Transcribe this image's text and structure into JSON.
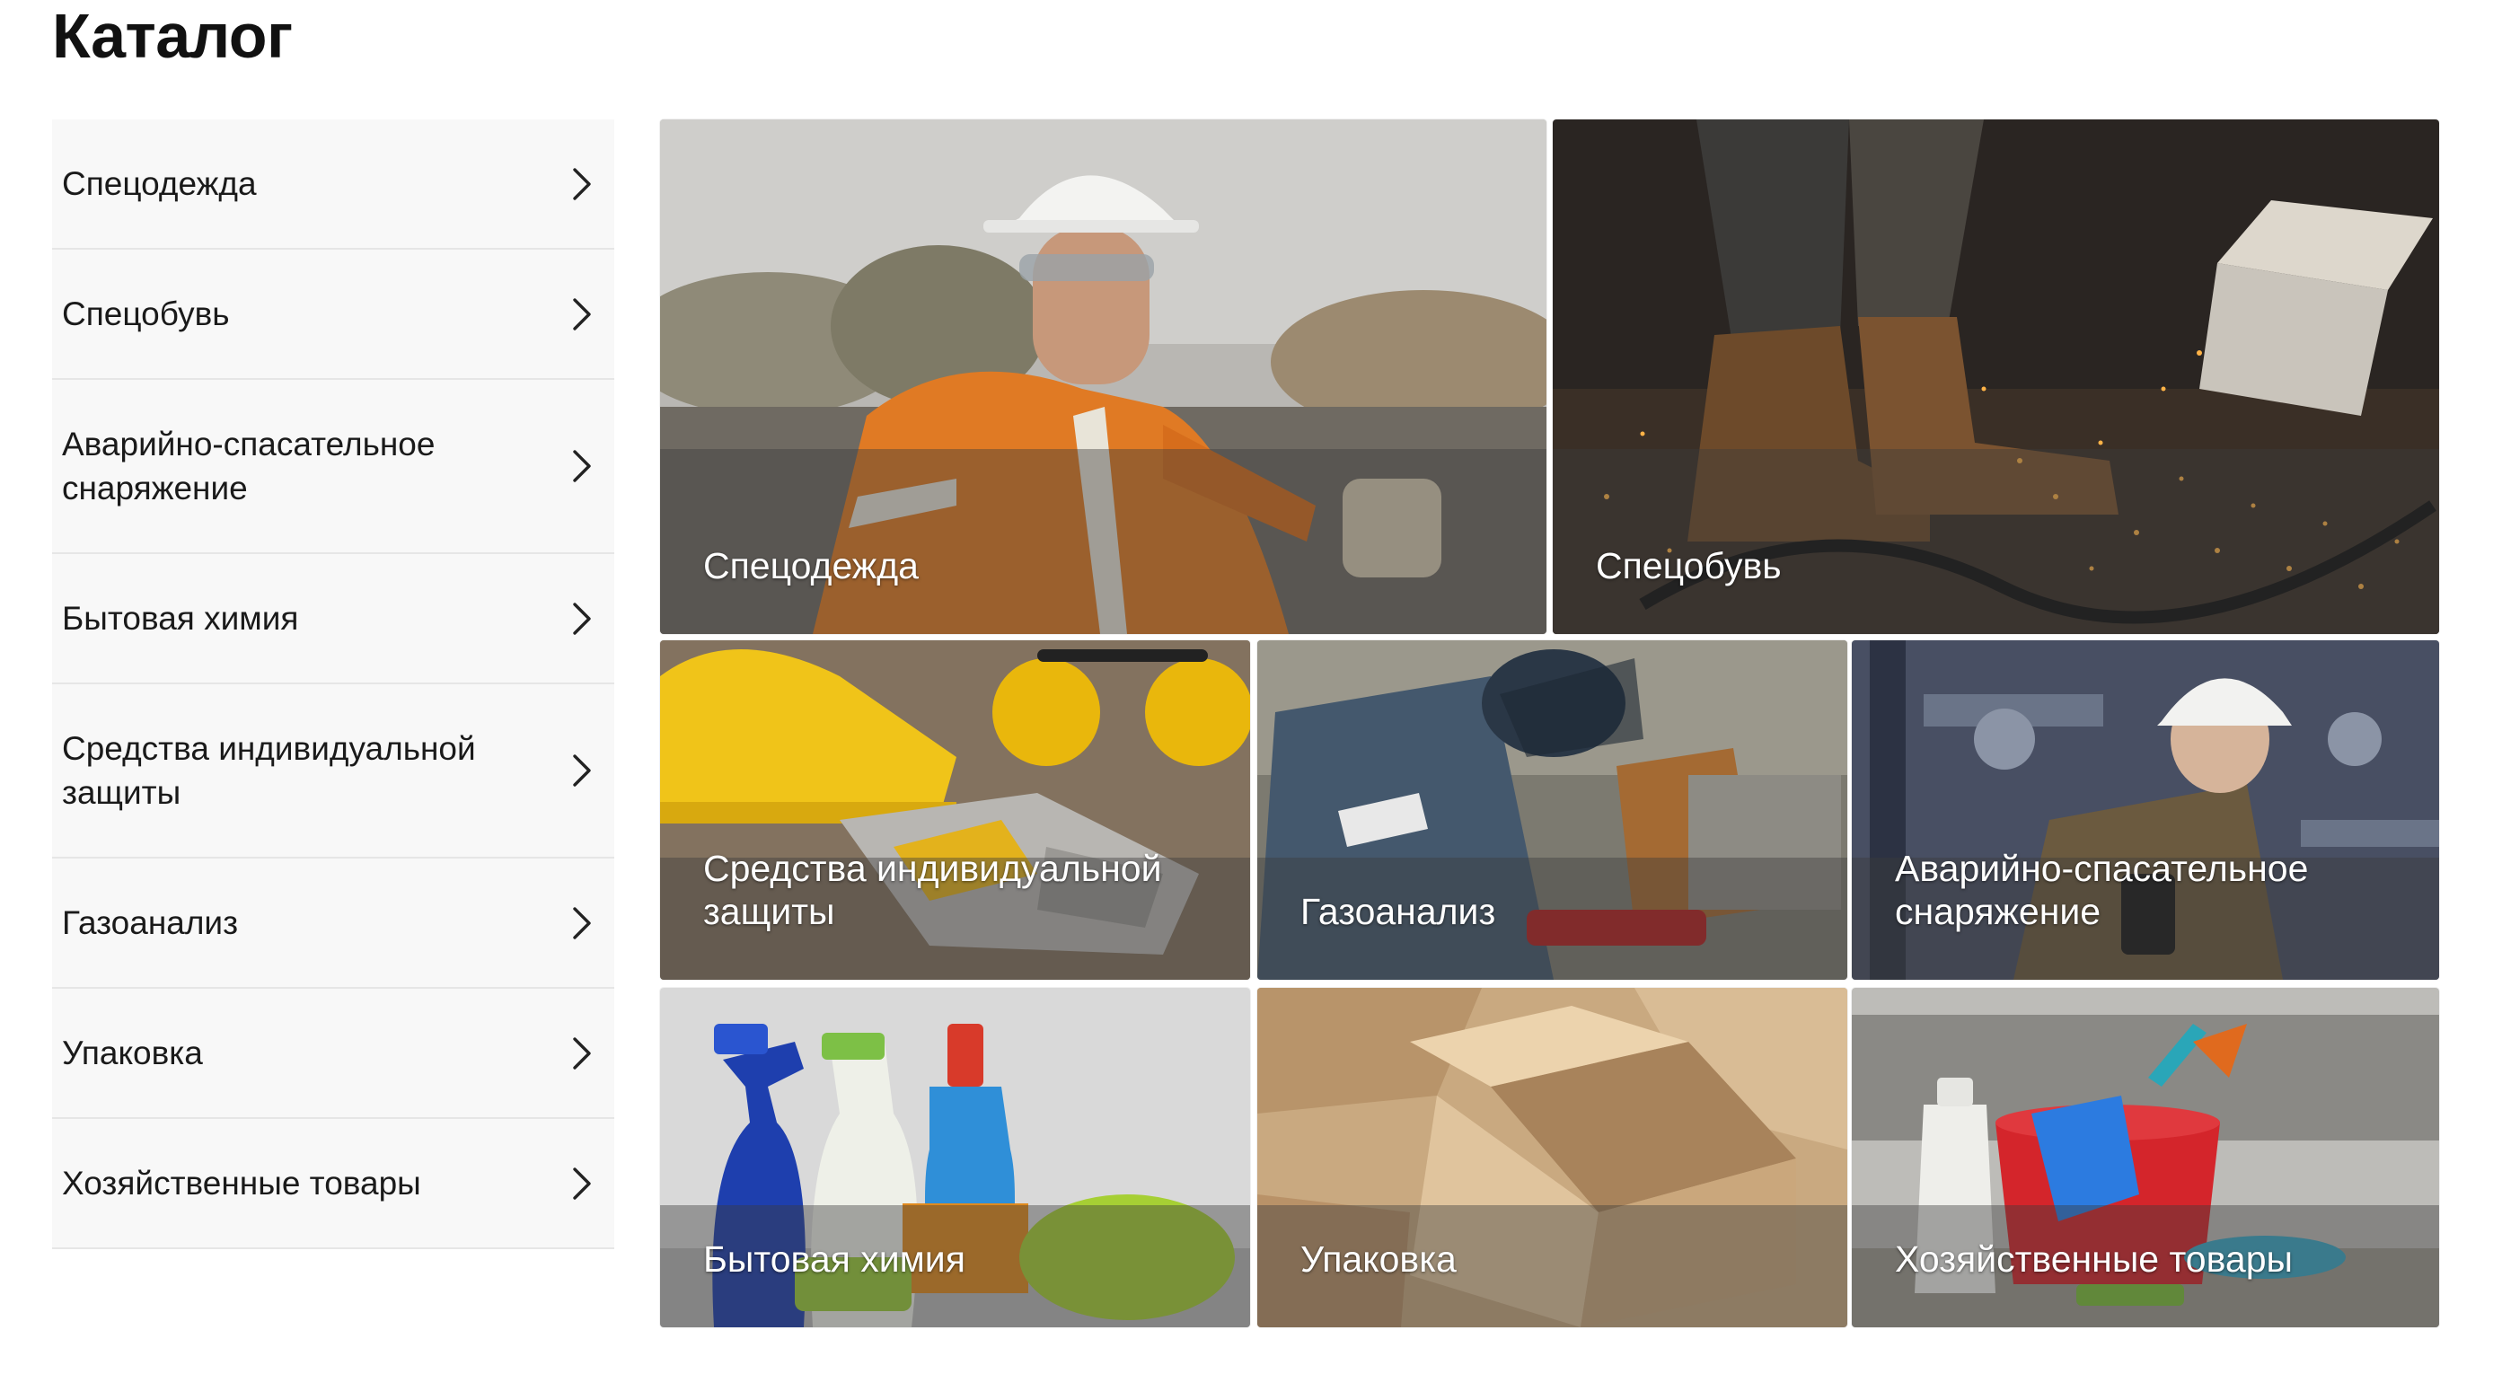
{
  "page": {
    "title": "Каталог"
  },
  "sidebar": {
    "items": [
      {
        "label": "Спецодежда",
        "icon": "chevron-right-icon"
      },
      {
        "label": "Спецобувь",
        "icon": "chevron-right-icon"
      },
      {
        "label": "Аварийно-спасательное снаряжение",
        "icon": "chevron-right-icon"
      },
      {
        "label": "Бытовая химия",
        "icon": "chevron-right-icon"
      },
      {
        "label": "Средства индивидуальной защиты",
        "icon": "chevron-right-icon"
      },
      {
        "label": "Газоанализ",
        "icon": "chevron-right-icon"
      },
      {
        "label": "Упаковка",
        "icon": "chevron-right-icon"
      },
      {
        "label": "Хозяйственные товары",
        "icon": "chevron-right-icon"
      }
    ]
  },
  "tiles": [
    {
      "label": "Спецодежда",
      "image": "worker-in-orange-workwear-photo"
    },
    {
      "label": "Спецобувь",
      "image": "work-boots-with-sparks-photo"
    },
    {
      "label": "Средства индивидуальной защиты",
      "image": "helmet-gloves-earmuffs-photo"
    },
    {
      "label": "Газоанализ",
      "image": "rescuers-with-hydraulic-tool-photo"
    },
    {
      "label": "Аварийно-спасательное снаряжение",
      "image": "engineer-with-gas-detector-photo"
    },
    {
      "label": "Бытовая химия",
      "image": "cleaning-bottles-photo"
    },
    {
      "label": "Упаковка",
      "image": "cardboard-boxes-photo"
    },
    {
      "label": "Хозяйственные товары",
      "image": "cleaning-bucket-supplies-photo"
    }
  ],
  "colors": {
    "sidebar_bg": "#f8f8f8",
    "divider": "#e6e6e6",
    "tile_label": "#ffffff"
  }
}
